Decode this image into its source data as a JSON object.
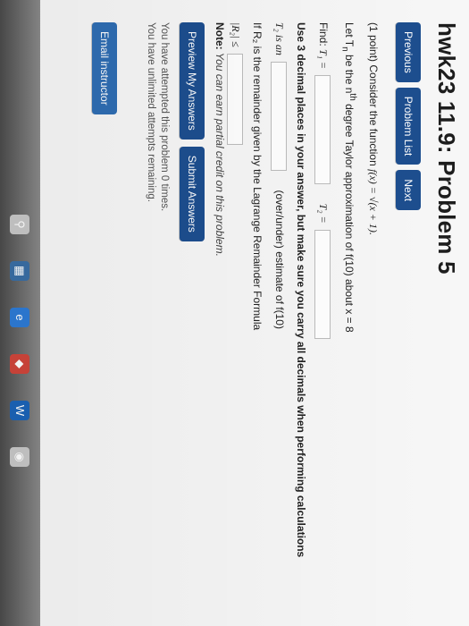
{
  "header": {
    "title": "hwk23 11.9: Problem 5"
  },
  "nav": {
    "previous": "Previous",
    "problem_list": "Problem List",
    "next": "Next"
  },
  "problem": {
    "intro": "(1 point) Consider the function",
    "function": "f(x) = √(x + 1).",
    "let_text": "Let T",
    "let_sub": "n",
    "let_rest1": " be the n",
    "let_sup": "th",
    "let_rest2": " degree Taylor approximation of f(10) about x = 8",
    "find_label": "Find:",
    "t1_label": "T₁ =",
    "t2_label": "T₂ =",
    "decimal_instruction": "Use 3 decimal places in your answer, but make sure you carry all decimals when performing calculations",
    "t2_is_an": "T₂ is an",
    "estimate_text": "(over/under) estimate of f(10)",
    "remainder_text": "If R₂ is the remainder given by the Lagrange Remainder Formula",
    "r2_label": "|R₂| ≤"
  },
  "note": {
    "label": "Note:",
    "text": " You can earn partial credit on this problem."
  },
  "actions": {
    "preview": "Preview My Answers",
    "submit": "Submit Answers"
  },
  "attempts": {
    "line1": "You have attempted this problem 0 times.",
    "line2": "You have unlimited attempts remaining."
  },
  "email": {
    "label": "Email instructor"
  },
  "colors": {
    "button": "#1d4e8f",
    "background": "#f7f7f7",
    "taskbar": "#4b4b4b"
  }
}
